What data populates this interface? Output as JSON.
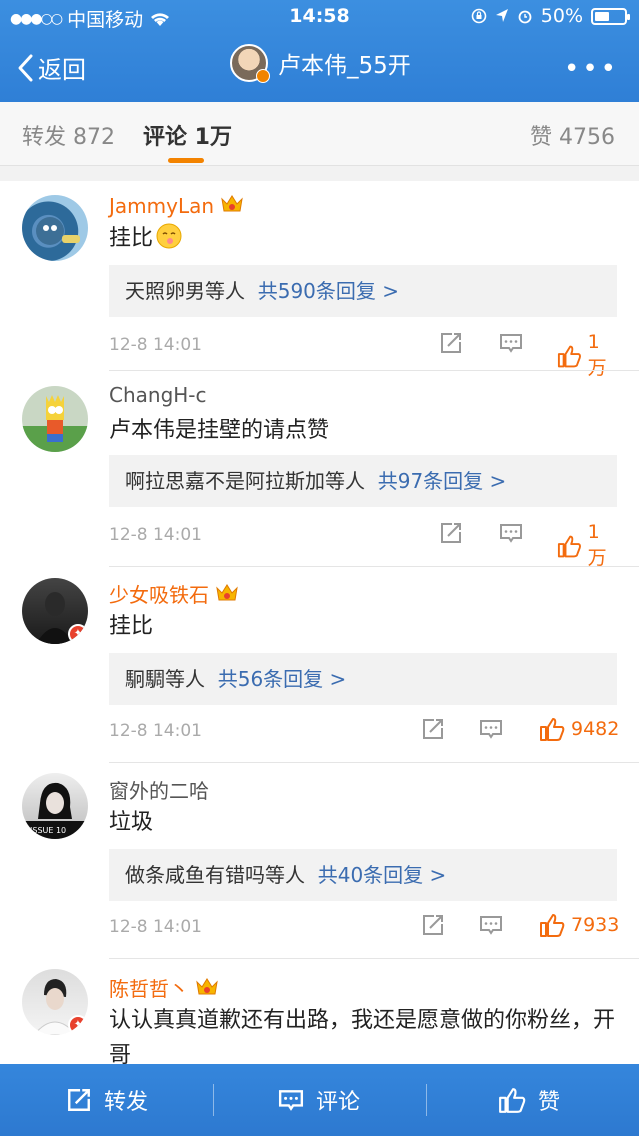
{
  "statusbar": {
    "carrier": "中国移动",
    "time": "14:58",
    "battery": "50%",
    "battery_level": 0.5
  },
  "navbar": {
    "back_label": "返回",
    "title": "卢本伟_55开"
  },
  "tabs": {
    "repost": "转发 872",
    "comment": "评论 1万",
    "like": "赞 4756"
  },
  "comments": [
    {
      "name": "JammyLan",
      "text": "挂比",
      "reply_users": "天照卵男等人",
      "reply_count": "共590条回复 >",
      "time": "12-8 14:01",
      "likes": "1万"
    },
    {
      "name": "ChangH-c",
      "text": "卢本伟是挂壁的请点赞",
      "reply_users": "啊拉思嘉不是阿拉斯加等人",
      "reply_count": "共97条回复 >",
      "time": "12-8 14:01",
      "likes": "1万"
    },
    {
      "name": "少女吸铁石",
      "text": "挂比",
      "reply_users": "駉騆等人",
      "reply_count": "共56条回复 >",
      "time": "12-8 14:01",
      "likes": "9482"
    },
    {
      "name": "窗外的二哈",
      "text": "垃圾",
      "reply_users": "做条咸鱼有错吗等人",
      "reply_count": "共40条回复 >",
      "time": "12-8 14:01",
      "likes": "7933"
    },
    {
      "name": "陈哲哲丶",
      "text": "认认真真道歉还有出路，我还是愿意做的你粉丝，开哥"
    }
  ],
  "bottombar": {
    "repost": "转发",
    "comment": "评论",
    "like": "赞"
  },
  "colors": {
    "brand_blue": "#2f7fd6",
    "accent_orange": "#f36b0e",
    "link_blue": "#3b6cb0"
  }
}
